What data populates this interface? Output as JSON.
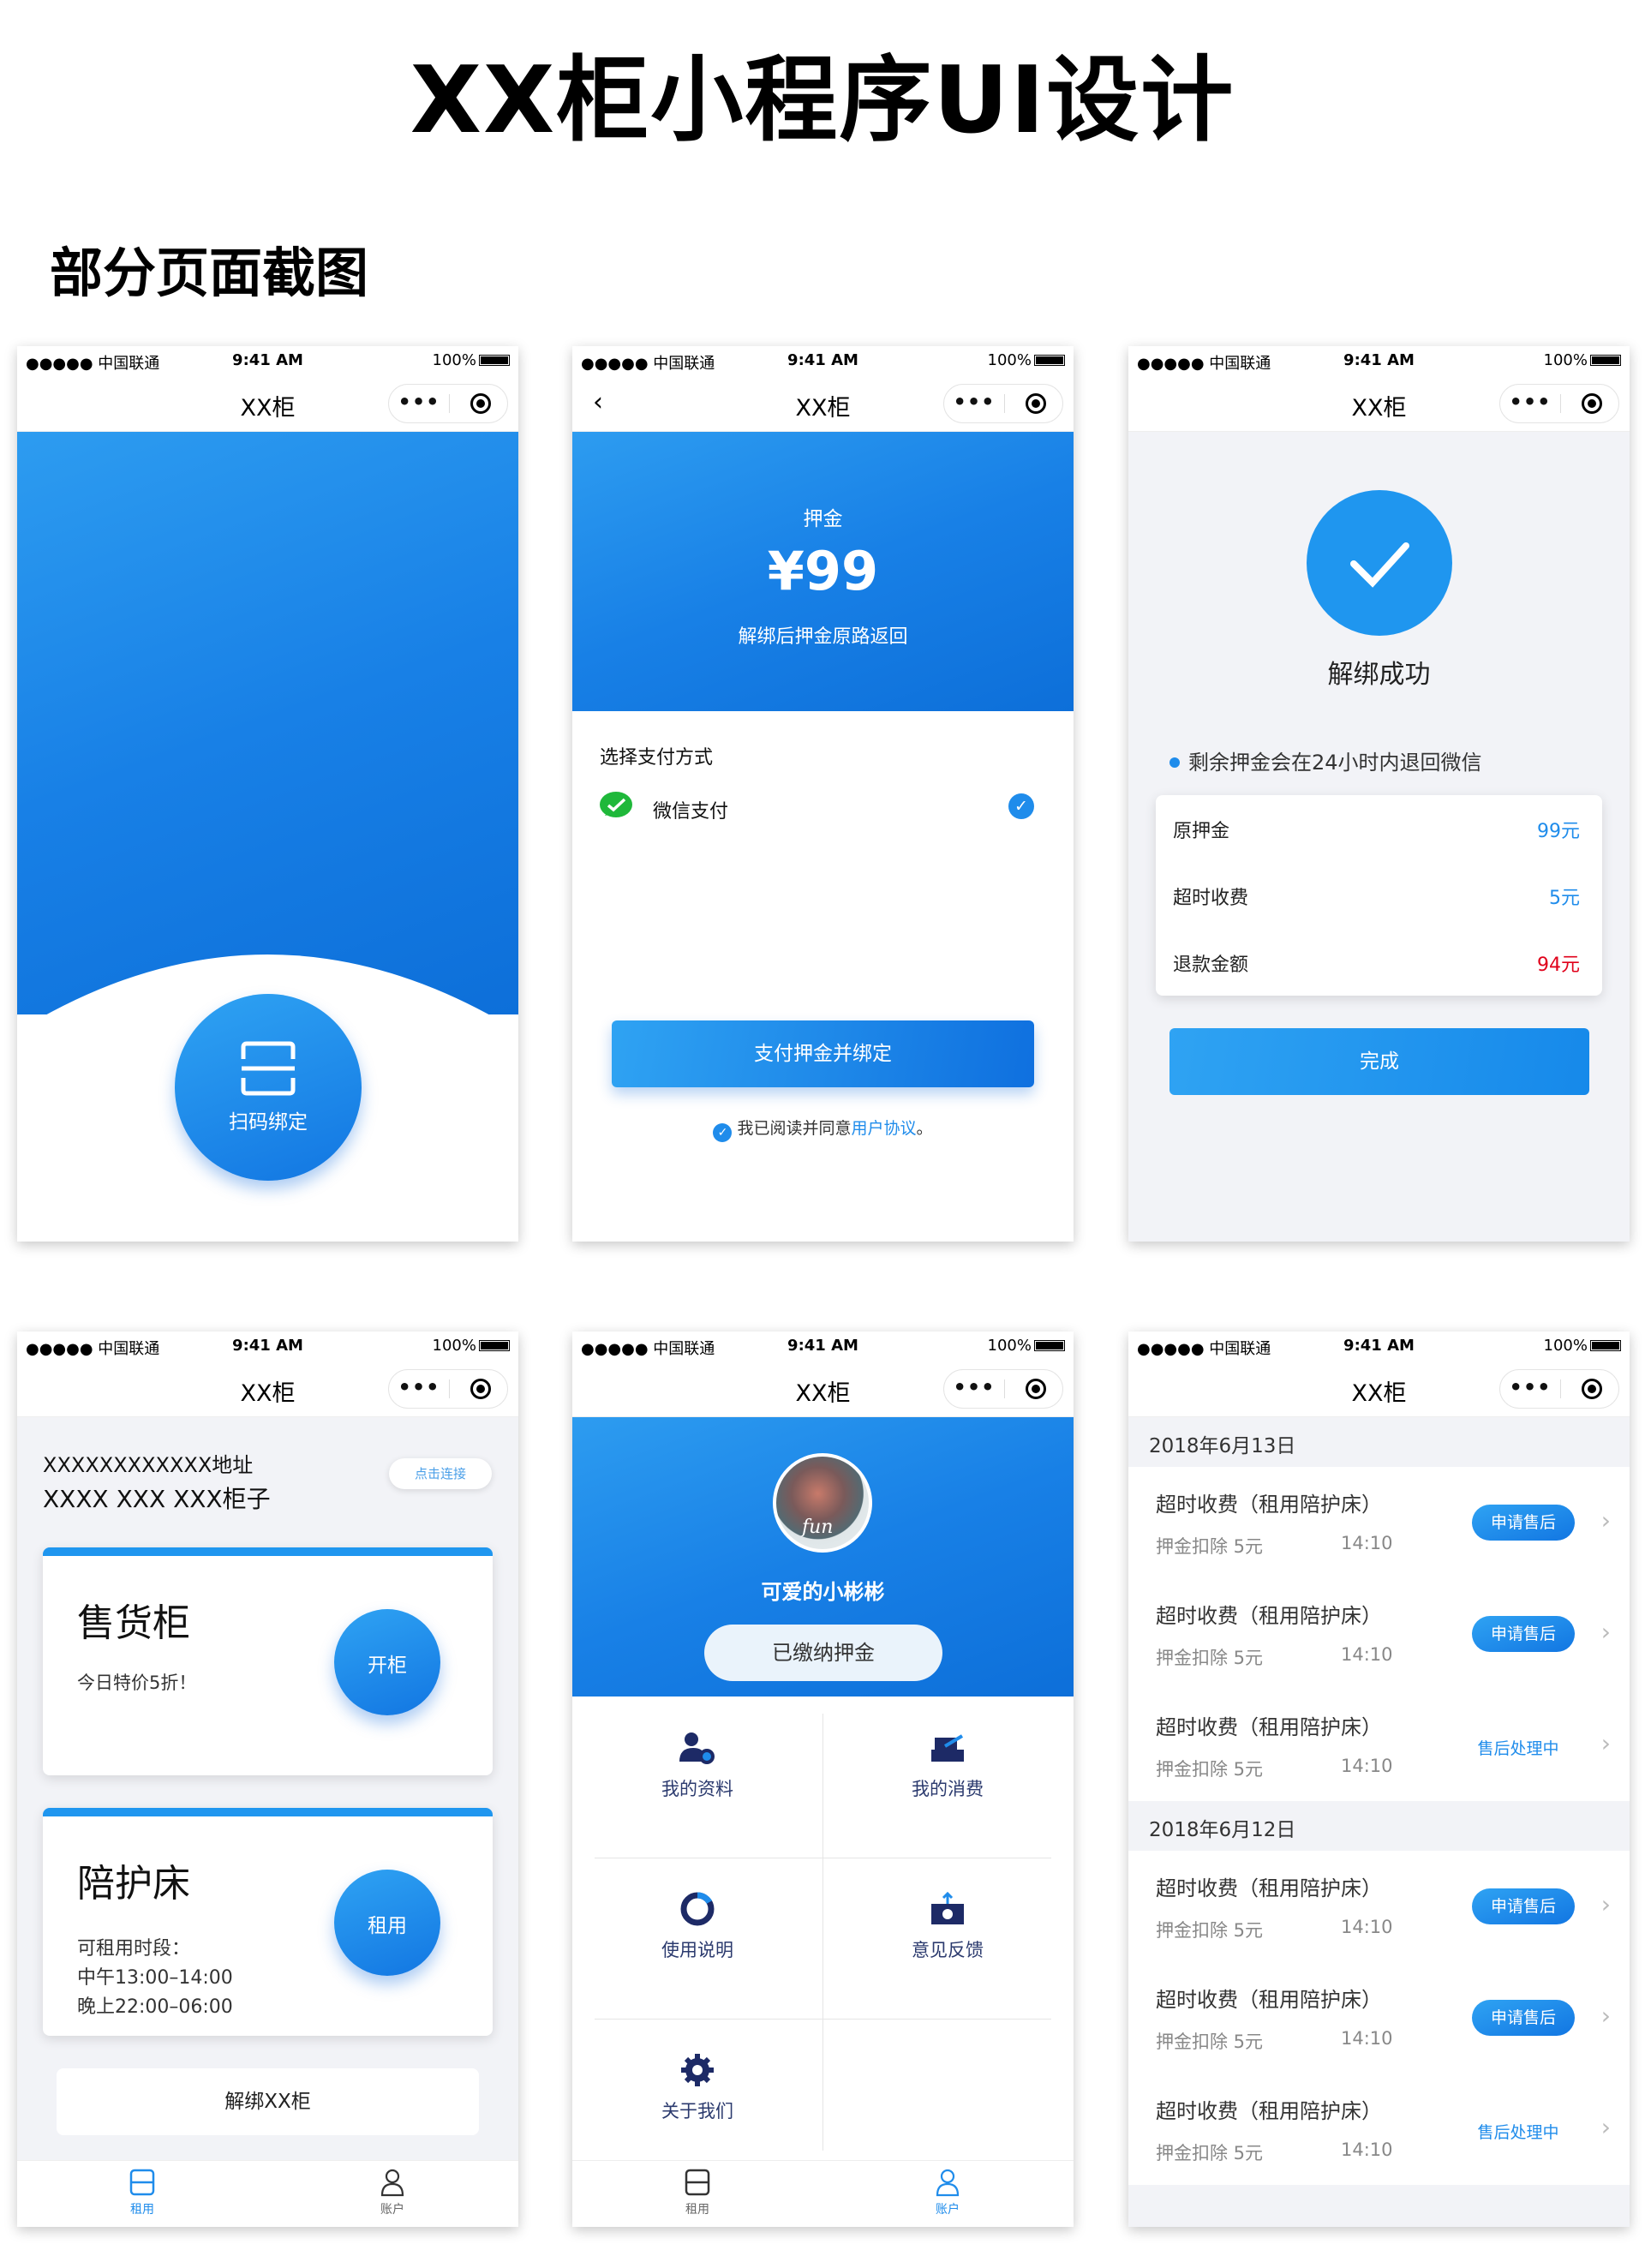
{
  "title": "XX柜小程序UI设计",
  "subtitle": "部分页面截图",
  "status": {
    "signal": "●●●●● 中国联通 ",
    "time": "9:41 AM",
    "battery": "100%"
  },
  "app_title": "XX柜",
  "capsule_more": "•••",
  "colors": {
    "accent": "#1f8ceb",
    "red": "#e0001a"
  },
  "screen1": {
    "scan_label": "扫码绑定"
  },
  "screen2": {
    "back": "‹",
    "deposit_label": "押金",
    "deposit_amount": "¥99",
    "deposit_note": "解绑后押金原路返回",
    "pay_method_title": "选择支付方式",
    "pay_option": "微信支付",
    "pay_button": "支付押金并绑定",
    "agree_prefix": "我已阅读并同意",
    "agree_link": "用户协议",
    "agree_suffix": "。"
  },
  "screen3": {
    "success_text": "解绑成功",
    "note": "剩余押金会在24小时内退回微信",
    "rows": [
      {
        "label": "原押金",
        "value": "99元"
      },
      {
        "label": "超时收费",
        "value": "5元"
      },
      {
        "label": "退款金额",
        "value": "94元"
      }
    ],
    "done_button": "完成"
  },
  "screen4": {
    "address_line1": "XXXXXXXXXXXX地址",
    "address_line2": "XXXX XXX XXX柜子",
    "connect_button": "点击连接",
    "vending": {
      "title": "售货柜",
      "desc": "今日特价5折！",
      "button": "开柜"
    },
    "bed": {
      "title": "陪护床",
      "line1": "可租用时段：",
      "line2": "中午13:00–14:00",
      "line3": "晚上22:00–06:00",
      "button": "租用"
    },
    "unbind_button": "解绑XX柜"
  },
  "tabs": {
    "rent": "租用",
    "account": "账户"
  },
  "screen5": {
    "avatar_text": "fun",
    "username": "可爱的小彬彬",
    "deposit_badge": "已缴纳押金",
    "menu": [
      "我的资料",
      "我的消费",
      "使用说明",
      "意见反馈",
      "关于我们"
    ]
  },
  "screen6": {
    "groups": [
      {
        "date": "2018年6月13日",
        "orders": [
          {
            "title": "超时收费（租用陪护床）",
            "sub": "押金扣除 5元",
            "time": "14:10",
            "action": "申请售后",
            "state": "button"
          },
          {
            "title": "超时收费（租用陪护床）",
            "sub": "押金扣除 5元",
            "time": "14:10",
            "action": "申请售后",
            "state": "button"
          },
          {
            "title": "超时收费（租用陪护床）",
            "sub": "押金扣除 5元",
            "time": "14:10",
            "action": "售后处理中",
            "state": "text"
          }
        ]
      },
      {
        "date": "2018年6月12日",
        "orders": [
          {
            "title": "超时收费（租用陪护床）",
            "sub": "押金扣除 5元",
            "time": "14:10",
            "action": "申请售后",
            "state": "button"
          },
          {
            "title": "超时收费（租用陪护床）",
            "sub": "押金扣除 5元",
            "time": "14:10",
            "action": "申请售后",
            "state": "button"
          },
          {
            "title": "超时收费（租用陪护床）",
            "sub": "押金扣除 5元",
            "time": "14:10",
            "action": "售后处理中",
            "state": "text"
          }
        ]
      }
    ],
    "chevron": "›"
  }
}
